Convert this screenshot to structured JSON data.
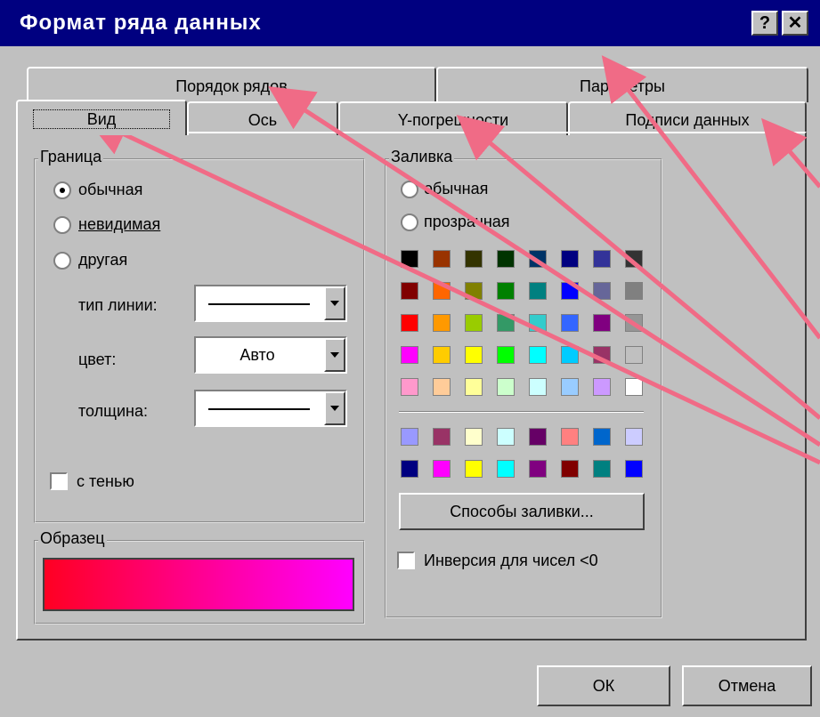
{
  "window": {
    "title": "Формат ряда данных",
    "help": "?",
    "close": "✕"
  },
  "tabs_back": [
    {
      "label": "Порядок рядов"
    },
    {
      "label": "Параметры"
    }
  ],
  "tabs_front": [
    {
      "label": "Вид"
    },
    {
      "label": "Ось"
    },
    {
      "label": "Y-погрешности"
    },
    {
      "label": "Подписи данных"
    }
  ],
  "border": {
    "legend": "Граница",
    "options": [
      {
        "label": "обычная",
        "checked": true
      },
      {
        "label": "невидимая",
        "checked": false
      },
      {
        "label": "другая",
        "checked": false
      }
    ],
    "line_type_label": "тип линии:",
    "color_label": "цвет:",
    "color_value": "Авто",
    "weight_label": "толщина:",
    "shadow_label": "с тенью"
  },
  "sample": {
    "legend": "Образец",
    "gradient_from": "#ff0022",
    "gradient_to": "#ff00ff"
  },
  "fill": {
    "legend": "Заливка",
    "options": [
      {
        "label": "обычная",
        "checked": false
      },
      {
        "label": "прозрачная",
        "checked": false
      }
    ],
    "palette": [
      [
        "#000000",
        "#993300",
        "#333300",
        "#003300",
        "#003366",
        "#000080",
        "#333399",
        "#333333"
      ],
      [
        "#800000",
        "#ff6600",
        "#808000",
        "#008000",
        "#008080",
        "#0000ff",
        "#666699",
        "#808080"
      ],
      [
        "#ff0000",
        "#ff9900",
        "#99cc00",
        "#339966",
        "#33cccc",
        "#3366ff",
        "#800080",
        "#969696"
      ],
      [
        "#ff00ff",
        "#ffcc00",
        "#ffff00",
        "#00ff00",
        "#00ffff",
        "#00ccff",
        "#993366",
        "#c0c0c0"
      ],
      [
        "#ff99cc",
        "#ffcc99",
        "#ffff99",
        "#ccffcc",
        "#ccffff",
        "#99ccff",
        "#cc99ff",
        "#ffffff"
      ]
    ],
    "palette_extra": [
      [
        "#9999ff",
        "#993366",
        "#ffffcc",
        "#ccffff",
        "#660066",
        "#ff8080",
        "#0066cc",
        "#ccccff"
      ],
      [
        "#000080",
        "#ff00ff",
        "#ffff00",
        "#00ffff",
        "#800080",
        "#800000",
        "#008080",
        "#0000ff"
      ]
    ],
    "fill_effects_label": "Способы заливки...",
    "invert_label": "Инверсия для чисел <0"
  },
  "buttons": {
    "ok": "ОК",
    "cancel": "Отмена"
  },
  "colors": {
    "titlebar": "#000080",
    "dialog": "#c0c0c0",
    "arrow": "#f06b86"
  }
}
